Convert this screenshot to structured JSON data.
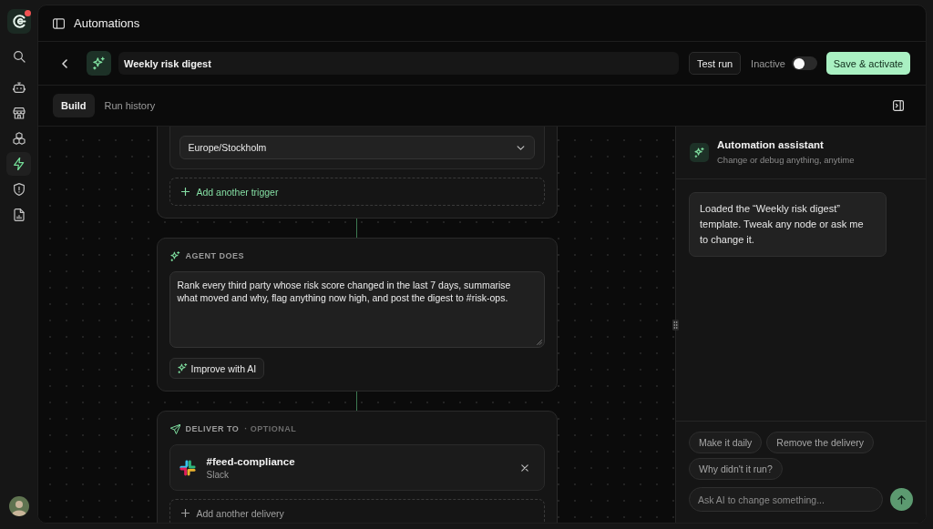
{
  "rail": {
    "notification": true,
    "items": [
      {
        "selected": false
      },
      {
        "selected": false
      },
      {
        "selected": false
      },
      {
        "selected": false
      },
      {
        "selected": true
      },
      {
        "selected": false
      },
      {
        "selected": false
      }
    ]
  },
  "header": {
    "title": "Automations"
  },
  "toolbar": {
    "name": "Weekly risk digest",
    "test_button": "Test run",
    "status_label": "Inactive",
    "active": false,
    "save_button": "Save & activate"
  },
  "tabs": [
    {
      "label": "Build",
      "selected": true
    },
    {
      "label": "Run history",
      "selected": false
    }
  ],
  "canvas": {
    "trigger": {
      "timezone": "Europe/Stockholm",
      "add_button": {
        "label": "Add another trigger",
        "highlighted": true
      }
    },
    "agent": {
      "heading": "AGENT DOES",
      "prompt": "Rank every third party whose risk score changed in the last 7 days, summarise what moved and why, flag anything now high, and post the digest to #risk-ops.",
      "improve_button": "Improve with AI"
    },
    "delivery": {
      "heading": "DELIVER TO",
      "note": "· OPTIONAL",
      "destinations": [
        {
          "name": "#feed-compliance",
          "service": "Slack"
        }
      ],
      "add_button": {
        "label": "Add another delivery",
        "highlighted": false
      }
    }
  },
  "assistant": {
    "title": "Automation assistant",
    "subtitle": "Change or debug anything, anytime",
    "messages": [
      {
        "text": "Loaded the “Weekly risk digest” template. Tweak any node or ask me to change it."
      }
    ],
    "suggestions": [
      "Make it daily",
      "Remove the delivery",
      "Why didn't it run?"
    ],
    "input": {
      "placeholder": "Ask AI to change something..."
    }
  }
}
